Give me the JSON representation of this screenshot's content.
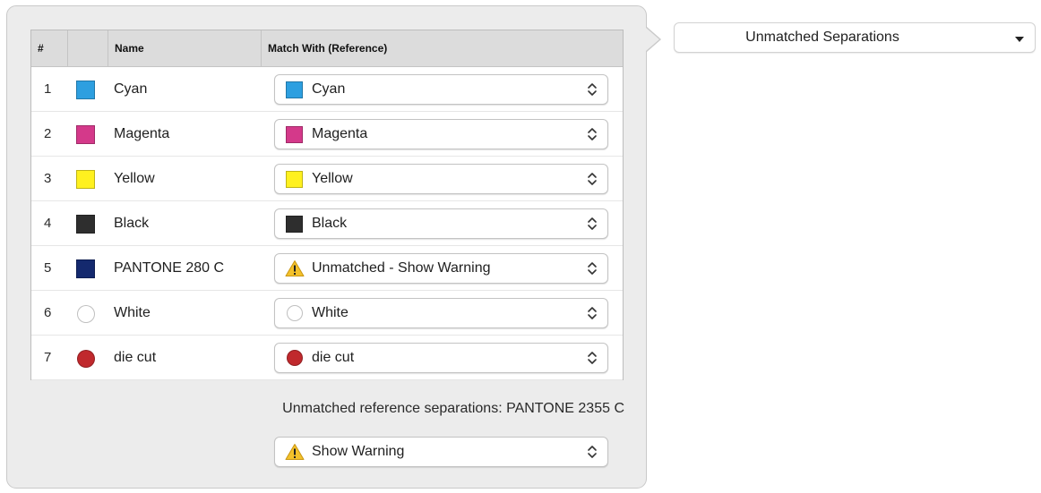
{
  "table": {
    "headers": {
      "num": "#",
      "swatch": "",
      "name": "Name",
      "match": "Match With (Reference)"
    },
    "rows": [
      {
        "num": "1",
        "name": "Cyan",
        "color": "#2d9fe0",
        "shape": "square",
        "match": {
          "label": "Cyan",
          "icon": "color-swatch",
          "color": "#2d9fe0",
          "shape": "square"
        }
      },
      {
        "num": "2",
        "name": "Magenta",
        "color": "#d4398a",
        "shape": "square",
        "match": {
          "label": "Magenta",
          "icon": "color-swatch",
          "color": "#d4398a",
          "shape": "square"
        }
      },
      {
        "num": "3",
        "name": "Yellow",
        "color": "#fff11f",
        "shape": "square",
        "match": {
          "label": "Yellow",
          "icon": "color-swatch",
          "color": "#fff11f",
          "shape": "square"
        }
      },
      {
        "num": "4",
        "name": "Black",
        "color": "#2e2e2e",
        "shape": "square",
        "match": {
          "label": "Black",
          "icon": "color-swatch",
          "color": "#2e2e2e",
          "shape": "square"
        }
      },
      {
        "num": "5",
        "name": "PANTONE 280 C",
        "color": "#14296e",
        "shape": "square",
        "match": {
          "label": "Unmatched - Show Warning",
          "icon": "warning-icon",
          "color": "#f3c12b",
          "shape": "warning"
        }
      },
      {
        "num": "6",
        "name": "White",
        "color": "#ffffff",
        "shape": "circle",
        "match": {
          "label": "White",
          "icon": "color-swatch",
          "color": "#ffffff",
          "shape": "circle"
        }
      },
      {
        "num": "7",
        "name": "die cut",
        "color": "#c0292d",
        "shape": "circle",
        "match": {
          "label": "die cut",
          "icon": "color-swatch",
          "color": "#c0292d",
          "shape": "circle"
        }
      }
    ]
  },
  "unmatched_reference": "Unmatched reference separations: PANTONE 2355 C",
  "unmatched_action": {
    "label": "Show Warning",
    "icon": "warning-icon"
  },
  "view_select": {
    "label": "Unmatched Separations",
    "icon": "caret-down-icon"
  },
  "colors": {
    "panel_bg": "#ececec",
    "header_bg": "#dcdcdc",
    "warning": "#f3c12b"
  }
}
